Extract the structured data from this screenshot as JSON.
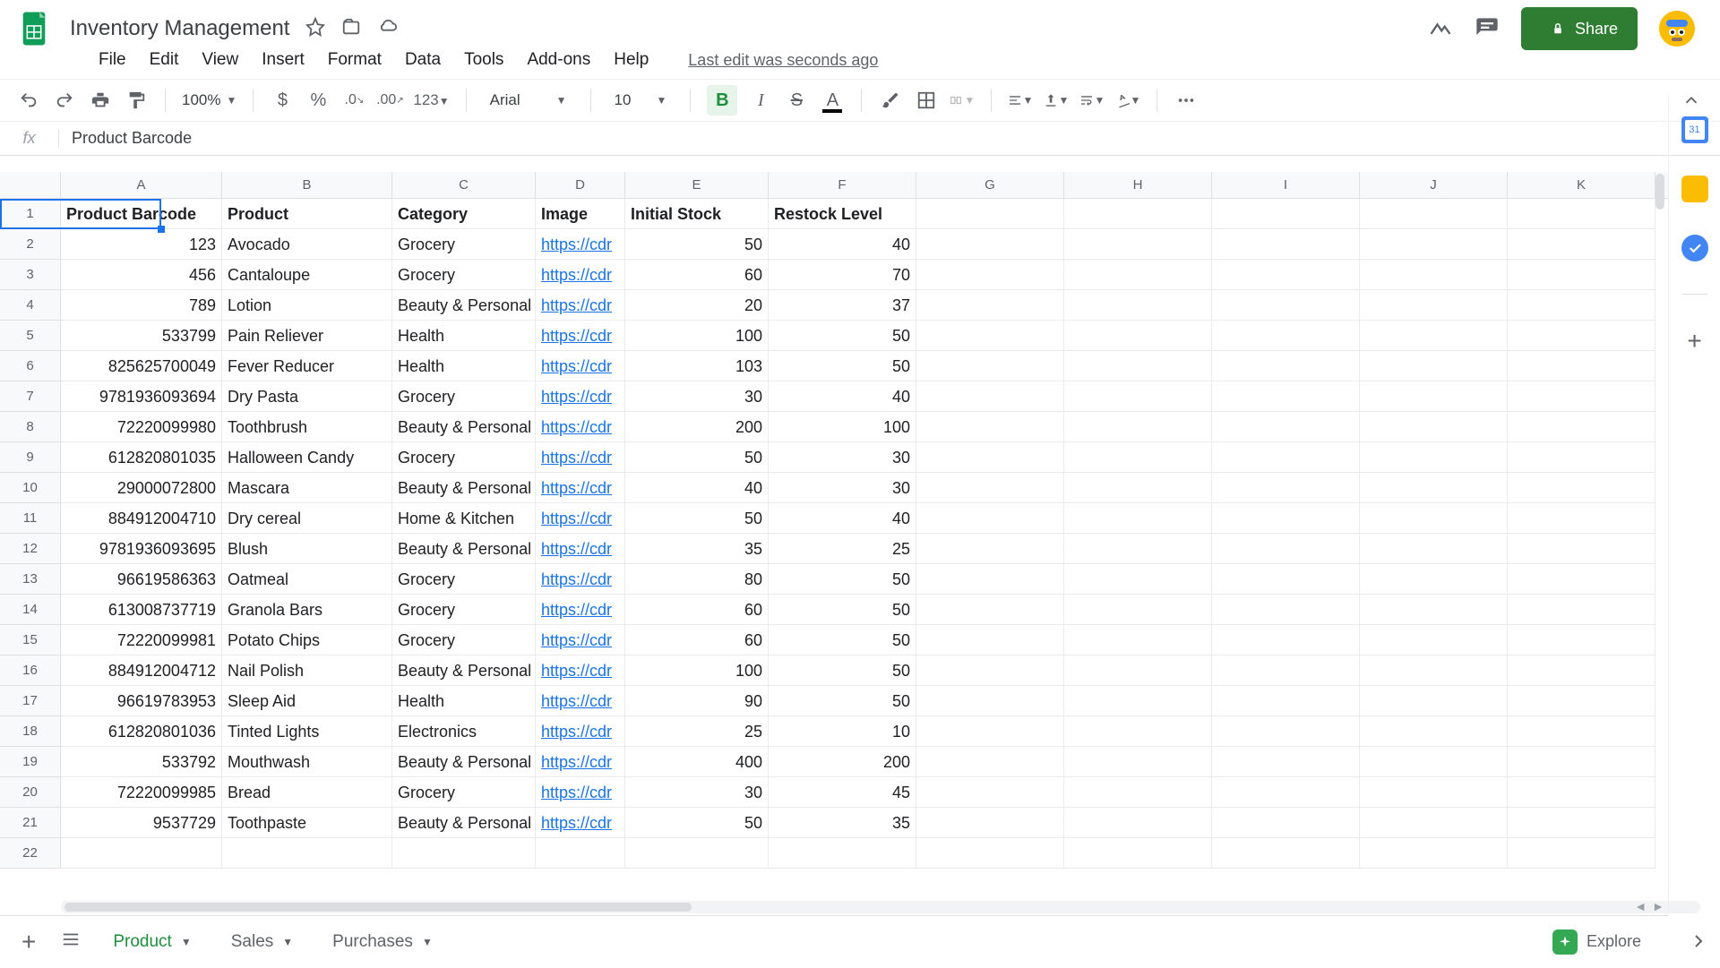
{
  "doc": {
    "title": "Inventory Management",
    "edit_info": "Last edit was seconds ago"
  },
  "menus": {
    "file": "File",
    "edit": "Edit",
    "view": "View",
    "insert": "Insert",
    "format": "Format",
    "data": "Data",
    "tools": "Tools",
    "addons": "Add-ons",
    "help": "Help"
  },
  "share": {
    "label": "Share"
  },
  "toolbar": {
    "zoom": "100%",
    "font": "Arial",
    "font_size": "10"
  },
  "formula": {
    "fx": "fx",
    "value": "Product Barcode"
  },
  "columns": {
    "letters": [
      "A",
      "B",
      "C",
      "D",
      "E",
      "F",
      "G",
      "H",
      "I",
      "J",
      "K"
    ],
    "widths": [
      180,
      190,
      160,
      100,
      160,
      165,
      165,
      165,
      165,
      165,
      165
    ]
  },
  "headers": {
    "a": "Product Barcode",
    "b": "Product",
    "c": "Category",
    "d": "Image",
    "e": "Initial Stock",
    "f": "Restock Level"
  },
  "rows": [
    {
      "barcode": "123",
      "product": "Avocado",
      "category": "Grocery",
      "image": "https://cdr",
      "stock": "50",
      "restock": "40"
    },
    {
      "barcode": "456",
      "product": "Cantaloupe",
      "category": "Grocery",
      "image": "https://cdr",
      "stock": "60",
      "restock": "70"
    },
    {
      "barcode": "789",
      "product": "Lotion",
      "category": "Beauty & Personal",
      "image": "https://cdr",
      "stock": "20",
      "restock": "37"
    },
    {
      "barcode": "533799",
      "product": "Pain Reliever",
      "category": "Health",
      "image": "https://cdr",
      "stock": "100",
      "restock": "50"
    },
    {
      "barcode": "825625700049",
      "product": "Fever Reducer",
      "category": "Health",
      "image": "https://cdr",
      "stock": "103",
      "restock": "50"
    },
    {
      "barcode": "9781936093694",
      "product": "Dry Pasta",
      "category": "Grocery",
      "image": "https://cdr",
      "stock": "30",
      "restock": "40"
    },
    {
      "barcode": "72220099980",
      "product": "Toothbrush",
      "category": "Beauty & Personal",
      "image": "https://cdr",
      "stock": "200",
      "restock": "100"
    },
    {
      "barcode": "612820801035",
      "product": "Halloween Candy",
      "category": "Grocery",
      "image": "https://cdr",
      "stock": "50",
      "restock": "30"
    },
    {
      "barcode": "29000072800",
      "product": "Mascara",
      "category": "Beauty & Personal",
      "image": "https://cdr",
      "stock": "40",
      "restock": "30"
    },
    {
      "barcode": "884912004710",
      "product": "Dry cereal",
      "category": "Home & Kitchen",
      "image": "https://cdr",
      "stock": "50",
      "restock": "40"
    },
    {
      "barcode": "9781936093695",
      "product": "Blush",
      "category": "Beauty & Personal",
      "image": "https://cdr",
      "stock": "35",
      "restock": "25"
    },
    {
      "barcode": "96619586363",
      "product": "Oatmeal",
      "category": "Grocery",
      "image": "https://cdr",
      "stock": "80",
      "restock": "50"
    },
    {
      "barcode": "613008737719",
      "product": "Granola Bars",
      "category": "Grocery",
      "image": "https://cdr",
      "stock": "60",
      "restock": "50"
    },
    {
      "barcode": "72220099981",
      "product": "Potato Chips",
      "category": "Grocery",
      "image": "https://cdr",
      "stock": "60",
      "restock": "50"
    },
    {
      "barcode": "884912004712",
      "product": "Nail Polish",
      "category": "Beauty & Personal",
      "image": "https://cdr",
      "stock": "100",
      "restock": "50"
    },
    {
      "barcode": "96619783953",
      "product": "Sleep Aid",
      "category": "Health",
      "image": "https://cdr",
      "stock": "90",
      "restock": "50"
    },
    {
      "barcode": "612820801036",
      "product": "Tinted Lights",
      "category": "Electronics",
      "image": "https://cdr",
      "stock": "25",
      "restock": "10"
    },
    {
      "barcode": "533792",
      "product": "Mouthwash",
      "category": "Beauty & Personal",
      "image": "https://cdr",
      "stock": "400",
      "restock": "200"
    },
    {
      "barcode": "72220099985",
      "product": "Bread",
      "category": "Grocery",
      "image": "https://cdr",
      "stock": "30",
      "restock": "45"
    },
    {
      "barcode": "9537729",
      "product": "Toothpaste",
      "category": "Beauty & Personal",
      "image": "https://cdr",
      "stock": "50",
      "restock": "35"
    }
  ],
  "sheets": {
    "product": "Product",
    "sales": "Sales",
    "purchases": "Purchases"
  },
  "explore": {
    "label": "Explore"
  }
}
